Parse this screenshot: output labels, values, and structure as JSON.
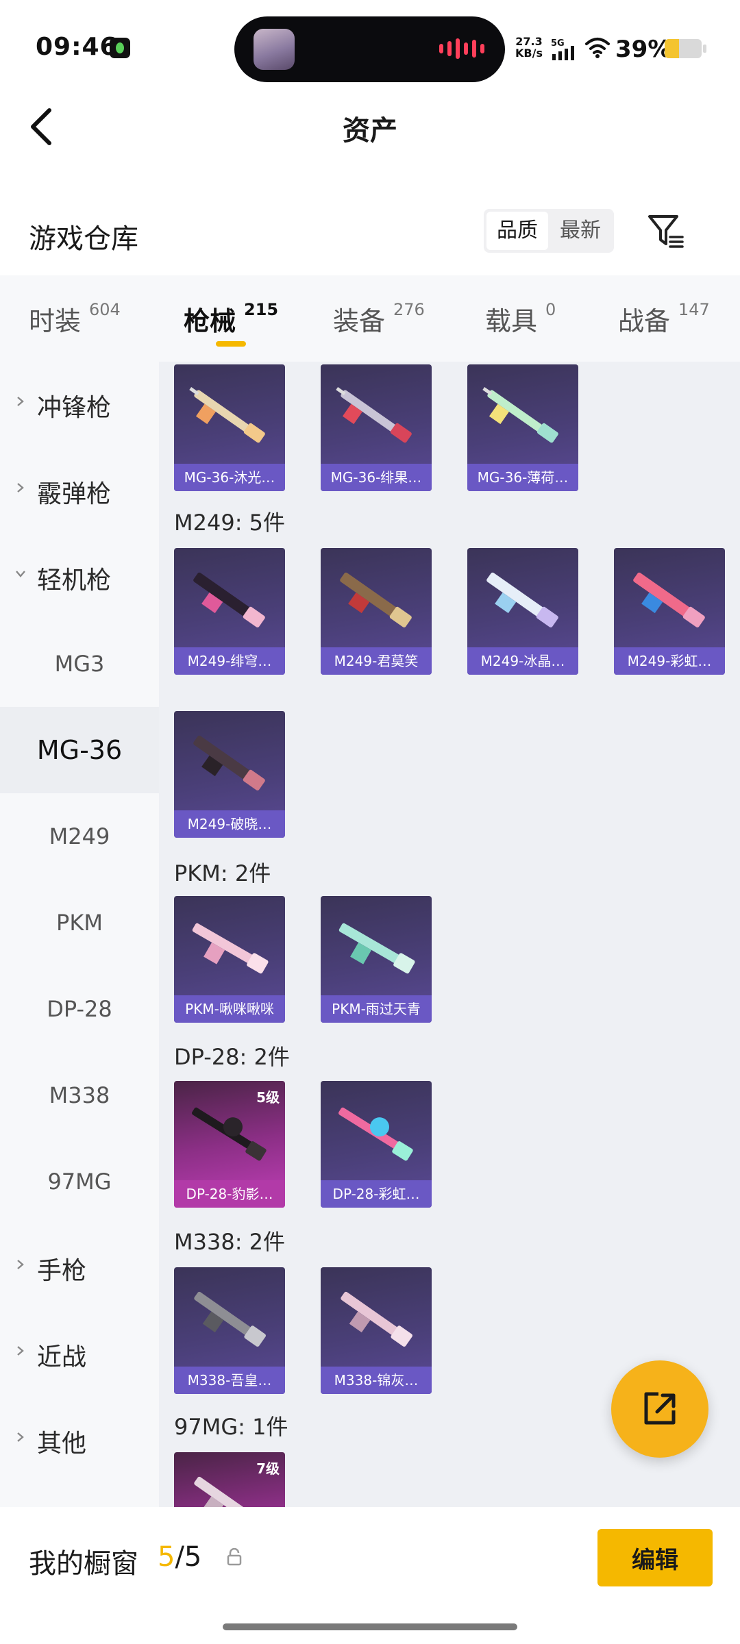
{
  "status_bar": {
    "time": "09:46",
    "net_speed": "27.3",
    "net_unit": "KB/s",
    "network": "5G",
    "battery": "39%",
    "battery_level": 0.39
  },
  "header": {
    "title": "资产",
    "back_icon": "chevron-left-icon"
  },
  "warehouse": {
    "title": "游戏仓库",
    "sort_options": [
      "品质",
      "最新"
    ],
    "sort_selected": "品质",
    "filter_icon": "filter-icon"
  },
  "tabs": [
    {
      "label": "时装",
      "count": "604"
    },
    {
      "label": "枪械",
      "count": "215",
      "active": true
    },
    {
      "label": "装备",
      "count": "276"
    },
    {
      "label": "载具",
      "count": "0"
    },
    {
      "label": "战备",
      "count": "147"
    }
  ],
  "sidebar": {
    "categories_top": [
      "冲锋枪",
      "霰弹枪",
      "轻机枪"
    ],
    "subitems": [
      "MG3",
      "MG-36",
      "M249",
      "PKM",
      "DP-28",
      "M338",
      "97MG"
    ],
    "active_subitem": "MG-36",
    "categories_bottom": [
      "手枪",
      "近战",
      "其他"
    ]
  },
  "content": {
    "top_cards": [
      "MG-36-沐光…",
      "MG-36-绯果…",
      "MG-36-薄荷…"
    ],
    "groups": [
      {
        "title": "M249: 5件",
        "items": [
          "M249-绯穹…",
          "M249-君莫笑",
          "M249-冰晶…",
          "M249-彩虹…",
          "M249-破晓…"
        ]
      },
      {
        "title": "PKM: 2件",
        "items": [
          "PKM-啾咪啾咪",
          "PKM-雨过天青"
        ]
      },
      {
        "title": "DP-28: 2件",
        "items": [
          "DP-28-豹影…",
          "DP-28-彩虹…"
        ],
        "levels": [
          "5级",
          ""
        ]
      },
      {
        "title": "M338: 2件",
        "items": [
          "M338-吾皇…",
          "M338-锦灰…"
        ]
      },
      {
        "title": "97MG: 1件",
        "items": [
          ""
        ],
        "levels": [
          "7级"
        ]
      }
    ]
  },
  "fab": {
    "icon": "share-external-icon"
  },
  "bottom": {
    "label": "我的橱窗",
    "count_current": "5",
    "count_sep": "/5",
    "lock_icon": "lock-open-icon",
    "edit_label": "编辑"
  },
  "colors": {
    "accent": "#f5b800",
    "card_purple": "#6a58c4",
    "card_gold": "#b23aa8"
  }
}
